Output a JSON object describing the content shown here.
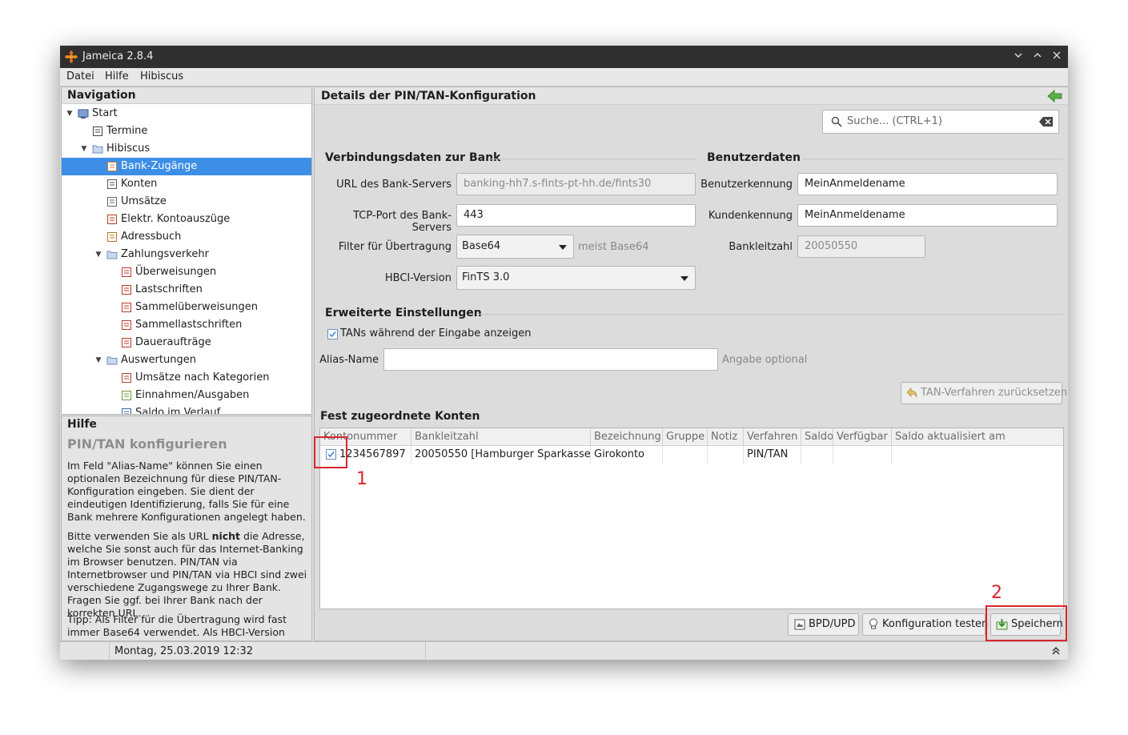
{
  "window": {
    "title": "Jameica 2.8.4",
    "menu": [
      "Datei",
      "Hilfe",
      "Hibiscus"
    ]
  },
  "navigation": {
    "header": "Navigation",
    "items": [
      {
        "label": "Start",
        "icon": "monitor-icon",
        "expanded": true
      },
      {
        "label": "Termine",
        "icon": "calendar-icon"
      },
      {
        "label": "Hibiscus",
        "icon": "folder-icon",
        "expanded": true
      },
      {
        "label": "Bank-Zugänge",
        "icon": "users-icon",
        "selected": true
      },
      {
        "label": "Konten",
        "icon": "account-icon"
      },
      {
        "label": "Umsätze",
        "icon": "transactions-icon"
      },
      {
        "label": "Elektr. Kontoauszüge",
        "icon": "pdf-icon"
      },
      {
        "label": "Adressbuch",
        "icon": "addressbook-icon"
      },
      {
        "label": "Zahlungsverkehr",
        "icon": "folder-icon",
        "expanded": true
      },
      {
        "label": "Überweisungen",
        "icon": "transfer-icon"
      },
      {
        "label": "Lastschriften",
        "icon": "debit-icon"
      },
      {
        "label": "Sammelüberweisungen",
        "icon": "batch-transfer-icon"
      },
      {
        "label": "Sammellastschriften",
        "icon": "batch-debit-icon"
      },
      {
        "label": "Daueraufträge",
        "icon": "clock-icon"
      },
      {
        "label": "Auswertungen",
        "icon": "folder-icon",
        "expanded": true
      },
      {
        "label": "Umsätze nach Kategorien",
        "icon": "chart-icon"
      },
      {
        "label": "Einnahmen/Ausgaben",
        "icon": "exchange-icon"
      },
      {
        "label": "Saldo im Verlauf",
        "icon": "line-chart-icon"
      }
    ]
  },
  "help": {
    "header": "Hilfe",
    "title": "PIN/TAN konfigurieren",
    "p1": "Im Feld \"Alias-Name\" können Sie einen optionalen Bezeichnung für diese PIN/TAN-Konfiguration eingeben. Sie dient der eindeutigen Identifizierung, falls Sie für eine Bank mehrere Konfigurationen angelegt haben.",
    "p2_pre": "Bitte verwenden Sie als URL ",
    "p2_bold": "nicht",
    "p2_post": " die Adresse, welche Sie sonst auch für das Internet-Banking im Browser benutzen. PIN/TAN via Internetbrowser und PIN/TAN via HBCI sind zwei verschiedene Zugangswege zu Ihrer Bank. Fragen Sie ggf. bei Ihrer Bank nach der korrekten URL.",
    "p3": "Tipp: Als Filter für die Übertragung wird fast immer Base64 verwendet. Als HBCI-Version"
  },
  "main": {
    "header": "Details der PIN/TAN-Konfiguration",
    "search_placeholder": "Suche...  (CTRL+1)",
    "connection": {
      "title": "Verbindungsdaten zur Bank",
      "url_label": "URL des Bank-Servers",
      "url_value": "banking-hh7.s-fints-pt-hh.de/fints30",
      "port_label": "TCP-Port des Bank-Servers",
      "port_value": "443",
      "filter_label": "Filter für Übertragung",
      "filter_value": "Base64",
      "filter_hint": "meist Base64",
      "hbci_label": "HBCI-Version",
      "hbci_value": "FinTS 3.0"
    },
    "user": {
      "title": "Benutzerdaten",
      "userid_label": "Benutzerkennung",
      "userid_value": "MeinAnmeldename",
      "customer_label": "Kundenkennung",
      "customer_value": "MeinAnmeldename",
      "blz_label": "Bankleitzahl",
      "blz_value": "20050550"
    },
    "advanced": {
      "title": "Erweiterte Einstellungen",
      "show_tans_label": "TANs während der Eingabe anzeigen",
      "show_tans_checked": true,
      "alias_label": "Alias-Name",
      "alias_value": "",
      "alias_hint": "Angabe optional",
      "reset_tan_button": "TAN-Verfahren zurücksetzen"
    },
    "accounts": {
      "title": "Fest zugeordnete Konten",
      "columns": [
        "Kontonummer",
        "Bankleitzahl",
        "Bezeichnung",
        "Gruppe",
        "Notiz",
        "Verfahren",
        "Saldo",
        "Verfügbar",
        "Saldo aktualisiert am"
      ],
      "rows": [
        {
          "checked": true,
          "cells": [
            "1234567897",
            "20050550 [Hamburger Sparkasse]",
            "Girokonto",
            "",
            "",
            "PIN/TAN",
            "",
            "",
            ""
          ]
        }
      ]
    },
    "buttons": {
      "bpd": "BPD/UPD",
      "test": "Konfiguration testen",
      "save": "Speichern"
    }
  },
  "status": {
    "datetime": "Montag, 25.03.2019 12:32"
  },
  "annotations": [
    "1",
    "2"
  ],
  "colors": {
    "selection": "#3d8ee6",
    "annotation": "#d9262b",
    "titlebar": "#2f2f2f"
  }
}
